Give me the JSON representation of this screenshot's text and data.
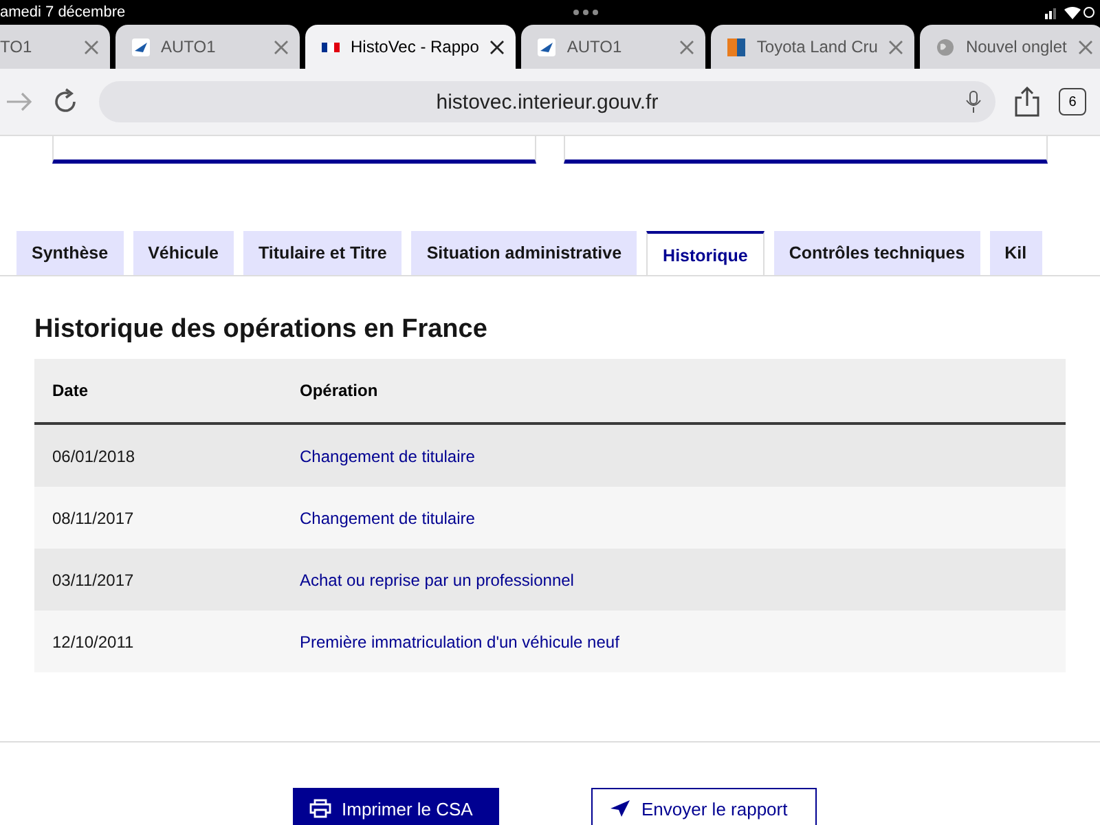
{
  "status_bar": {
    "date": "amedi 7 décembre"
  },
  "browser_tabs": [
    {
      "title": "TO1",
      "selected": false
    },
    {
      "title": "AUTO1",
      "kind": "auto",
      "selected": false
    },
    {
      "title": "HistoVec - Rappo",
      "kind": "flag",
      "selected": true
    },
    {
      "title": "AUTO1",
      "kind": "auto",
      "selected": false
    },
    {
      "title": "Toyota Land Cru",
      "kind": "orange",
      "selected": false
    },
    {
      "title": "Nouvel onglet",
      "kind": "globe",
      "selected": false
    }
  ],
  "address_bar": {
    "url": "histovec.interieur.gouv.fr",
    "tab_count": "6"
  },
  "tabs": [
    {
      "label": "Synthèse",
      "selected": false
    },
    {
      "label": "Véhicule",
      "selected": false
    },
    {
      "label": "Titulaire et Titre",
      "selected": false
    },
    {
      "label": "Situation administrative",
      "selected": false
    },
    {
      "label": "Historique",
      "selected": true
    },
    {
      "label": "Contrôles techniques",
      "selected": false
    },
    {
      "label": "Kil",
      "selected": false
    }
  ],
  "section": {
    "title": "Historique des opérations en France"
  },
  "table": {
    "columns": [
      "Date",
      "Opération"
    ],
    "rows": [
      {
        "date": "06/01/2018",
        "operation": "Changement de titulaire"
      },
      {
        "date": "08/11/2017",
        "operation": "Changement de titulaire"
      },
      {
        "date": "03/11/2017",
        "operation": "Achat ou reprise par un professionnel"
      },
      {
        "date": "12/10/2011",
        "operation": "Première immatriculation d'un véhicule neuf"
      }
    ]
  },
  "buttons": [
    {
      "label": "Imprimer le CSA",
      "kind": "primary"
    },
    {
      "label": "Envoyer le rapport",
      "kind": "secondary"
    }
  ]
}
